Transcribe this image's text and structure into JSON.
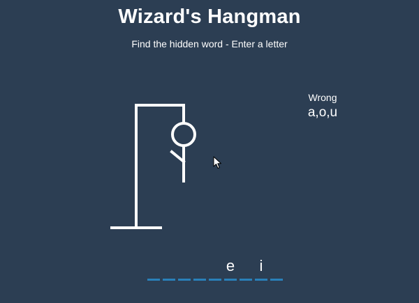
{
  "header": {
    "title": "Wizard's Hangman",
    "subtitle": "Find the hidden word - Enter a letter"
  },
  "wrong": {
    "title": "Wrong",
    "letters": "a,o,u"
  },
  "word": {
    "slots": [
      "",
      "",
      "",
      "",
      "",
      "e",
      "",
      "i",
      ""
    ]
  },
  "figure_parts_visible": [
    "gallows",
    "rope",
    "head",
    "body",
    "left-arm"
  ],
  "colors": {
    "background": "#2c3e53",
    "text": "#ffffff",
    "underline": "#2980b9",
    "figure": "#ffffff"
  }
}
